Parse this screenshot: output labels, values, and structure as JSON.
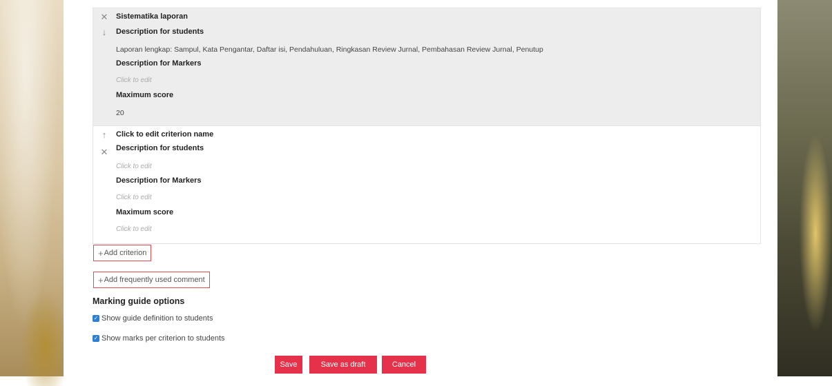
{
  "criteria": [
    {
      "name": "Sistematika laporan",
      "description_for_students_label": "Description for students",
      "description_for_students": "Laporan lengkap: Sampul, Kata Pengantar, Daftar isi, Pendahuluan, Ringkasan Review Jurnal, Pembahasan Review Jurnal, Penutup",
      "description_for_markers_label": "Description for Markers",
      "description_for_markers": "Click to edit",
      "maximum_score_label": "Maximum score",
      "maximum_score": "20"
    },
    {
      "name": "Click to edit criterion name",
      "description_for_students_label": "Description for students",
      "description_for_students": "Click to edit",
      "description_for_markers_label": "Description for Markers",
      "description_for_markers": "Click to edit",
      "maximum_score_label": "Maximum score",
      "maximum_score": "Click to edit"
    }
  ],
  "icons": {
    "delete": "✕",
    "move_down": "↓",
    "move_up": "↑",
    "plus": "+",
    "check": "✓"
  },
  "actions": {
    "add_criterion": "Add criterion",
    "add_comment": "Add frequently used comment"
  },
  "options": {
    "title": "Marking guide options",
    "show_definition": "Show guide definition to students",
    "show_marks": "Show marks per criterion to students"
  },
  "buttons": {
    "save": "Save",
    "save_draft": "Save as draft",
    "cancel": "Cancel"
  },
  "colors": {
    "accent_red": "#e5314a",
    "checkbox_blue": "#2d7fd3"
  }
}
